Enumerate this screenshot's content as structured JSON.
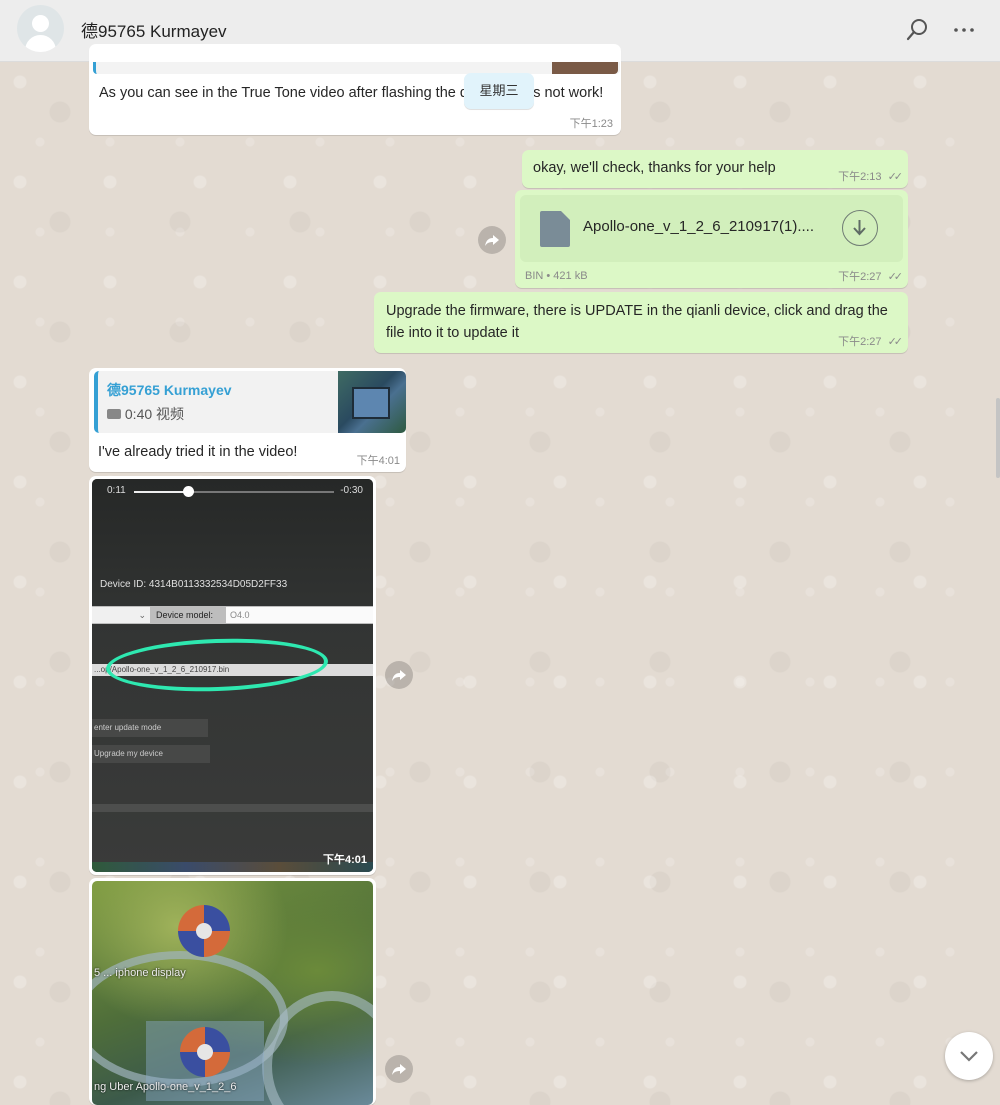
{
  "header": {
    "contact_name": "德95765 Kurmayev"
  },
  "date_separator": "星期三",
  "messages": {
    "m1": {
      "text": "As you can see in the True Tone video after flashing the display does not work!",
      "time": "下午1:23"
    },
    "m2": {
      "text": "okay, we'll check, thanks for your help",
      "time": "下午2:13",
      "status": "✓✓"
    },
    "m3": {
      "file_name": "Apollo-one_v_1_2_6_210917(1)....",
      "file_meta": "BIN • 421 kB",
      "time": "下午2:27",
      "status": "✓✓"
    },
    "m4": {
      "text": "Upgrade the firmware, there is UPDATE in the qianli device, click and drag the file into it to update it",
      "time": "下午2:27",
      "status": "✓✓"
    },
    "m5": {
      "quote_author": "德95765 Kurmayev",
      "quote_duration": "0:40",
      "quote_type": "视频",
      "text": "I've already tried it in the video!",
      "time": "下午4:01"
    },
    "m6": {
      "player_elapsed": "0:11",
      "player_remaining": "-0:30",
      "player_progress": 0.27,
      "screen_device_id": "Device ID:  4314B0113332534D05D2FF33",
      "screen_device_model_label": "Device model:",
      "screen_device_model_value": "O4.0",
      "screen_file_path": "...op/Apollo-one_v_1_2_6_210917.bin",
      "screen_btn_enter": "enter update mode",
      "screen_btn_upgrade": "Upgrade my device",
      "time": "下午4:01"
    },
    "m7": {
      "icon_label_1": "5 ... iphone  display",
      "icon_label_2": "ng Uber  Apollo-one_v_1_2_6"
    }
  },
  "colors": {
    "incoming_bubble": "#ffffff",
    "outgoing_bubble": "#dcf8c6",
    "quote_accent": "#35cd96",
    "quote_author": "#35a0d4",
    "circle_annotation": "#2ee8b0"
  }
}
